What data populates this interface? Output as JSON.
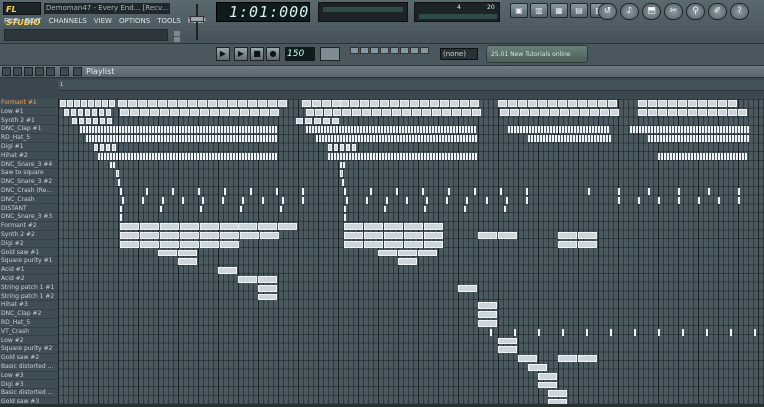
{
  "app": {
    "logo": "FL STUDIO",
    "song_title": "Demoman47 - Every End... [Recv...",
    "time": "1:01:000",
    "tempo": "150",
    "snap": "(none)",
    "news": "25.01 New Tutorials online"
  },
  "menu": [
    "FILE",
    "EDIT",
    "CHANNELS",
    "VIEW",
    "OPTIONS",
    "TOOLS",
    "HELP"
  ],
  "poly_panel": {
    "left": "4",
    "right": "20"
  },
  "window_buttons": [
    "▣",
    "▥",
    "▦",
    "▤",
    "▧"
  ],
  "tool_buttons": [
    "↺",
    "♪",
    "⬒",
    "✂",
    "⚲",
    "✐",
    "?"
  ],
  "transport": {
    "pat": "▶",
    "play": "▶",
    "stop": "■",
    "rec": "●"
  },
  "playlist": {
    "title": "Playlist",
    "ruler": [
      "1",
      "",
      "",
      "",
      "",
      "",
      "",
      "",
      "",
      "",
      "",
      "",
      "",
      "",
      "",
      "",
      "",
      "",
      "",
      "",
      "",
      "",
      "",
      "",
      "",
      "",
      "",
      "",
      "",
      "",
      ""
    ],
    "tracks": [
      "Formant #1",
      "Low #1",
      "Synth 2 #1",
      "DNC_Clap #1",
      "RD_Hat_5",
      "Digi #1",
      "Hihat #2",
      "DNC_Snare_3 #4",
      "Saw to square",
      "DNC_Snare_3 #2",
      "DNC_Crash (Re...",
      "DNC_Crash",
      "DISTANT",
      "DNC_Snare_3 #3",
      "Formant #2",
      "Synth 2 #2",
      "Digi #2",
      "Gold saw #1",
      "Square purity #1",
      "Acid #1",
      "Acid #2",
      "String patch 1 #1",
      "String patch 1 #2",
      "Hihat #3",
      "DNC_Clap #2",
      "RD_Hat_5",
      "VT_Crash",
      "Low #2",
      "Square purity #2",
      "Gold saw #2",
      "Basic distorted ...",
      "Low #3",
      "Digi #3",
      "Basic distorted ...",
      "Gold saw #3"
    ]
  }
}
